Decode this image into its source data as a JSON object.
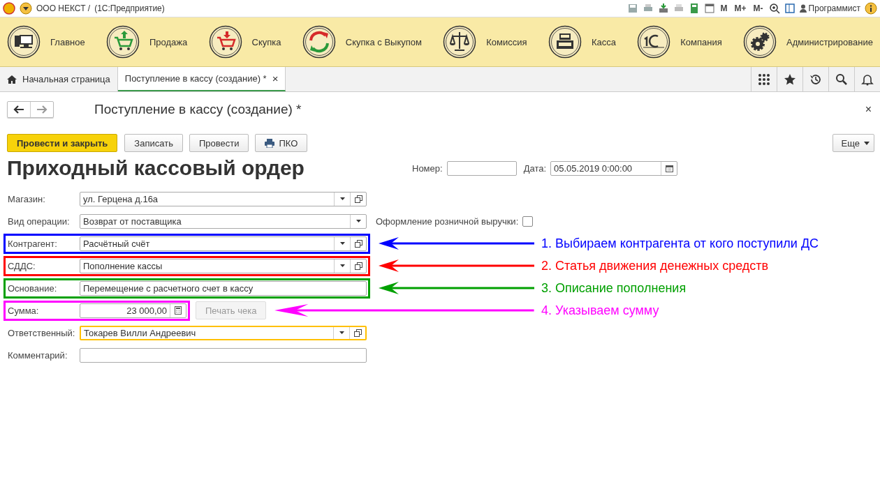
{
  "app_bar": {
    "org": "ООО НЕКСТ /",
    "app": "(1С:Предприятие)",
    "memory_buttons": [
      "M",
      "M+",
      "M-"
    ],
    "user": "Программист"
  },
  "sections": [
    {
      "label": "Главное",
      "kind": "computer"
    },
    {
      "label": "Продажа",
      "kind": "cart-up"
    },
    {
      "label": "Скупка",
      "kind": "cart-down"
    },
    {
      "label": "Скупка с Выкупом",
      "kind": "cycle"
    },
    {
      "label": "Комиссия",
      "kind": "scales"
    },
    {
      "label": "Касса",
      "kind": "register"
    },
    {
      "label": "Компания",
      "kind": "logo"
    },
    {
      "label": "Администрирование",
      "kind": "gears"
    }
  ],
  "tabs": [
    {
      "label": "Начальная страница",
      "kind": "home",
      "selected": false
    },
    {
      "label": "Поступление в кассу (создание) *",
      "kind": "document",
      "selected": true,
      "close": "×"
    }
  ],
  "form": {
    "title": "Поступление в кассу (создание) *",
    "close": "×",
    "buttons": [
      {
        "label": "Провести и закрыть",
        "primary": true
      },
      {
        "label": "Записать",
        "primary": false
      },
      {
        "label": "Провести",
        "primary": false
      },
      {
        "label": "ПКО",
        "primary": false,
        "kind": "printer"
      }
    ],
    "more": "Еще",
    "heading": "Приходный кассовый ордер",
    "number": {
      "label": "Номер:"
    },
    "date": {
      "label": "Дата:",
      "value": "05.05.2019  0:00:00"
    },
    "rows": [
      {
        "kind": "select",
        "label": "Магазин:",
        "value": "ул. Герцена д.16а",
        "open": true
      },
      {
        "kind": "select",
        "label": "Вид операции:",
        "value": "Возврат от поставщика",
        "open": false,
        "checkbox": {
          "label": "Оформление розничной выручки:",
          "checked": false
        }
      },
      {
        "kind": "select",
        "label": "Контрагент:",
        "value": "Расчётный счёт",
        "open": true,
        "color": "#0000ff",
        "annotation": "1. Выбираем контрагента от кого поступили ДС"
      },
      {
        "kind": "select",
        "label": "СДДС:",
        "value": "Пополнение кассы",
        "open": true,
        "color": "#ff0000",
        "annotation": "2. Статья движения денежных средств"
      },
      {
        "kind": "text",
        "label": "Основание:",
        "value": "Перемещение с расчетного счет в кассу",
        "color": "#00a000",
        "annotation": "3. Описание пополнения"
      },
      {
        "kind": "amount",
        "label": "Сумма:",
        "value": "23 000,00",
        "color": "#ff00ff",
        "annotation": "4. Указываем сумму",
        "button": {
          "label": "Печать чека",
          "disabled": true
        }
      },
      {
        "kind": "select",
        "label": "Ответственный:",
        "value": "Токарев Вилли Андреевич",
        "open": true,
        "color": "#ffc000"
      },
      {
        "kind": "text",
        "label": "Комментарий:"
      }
    ]
  }
}
